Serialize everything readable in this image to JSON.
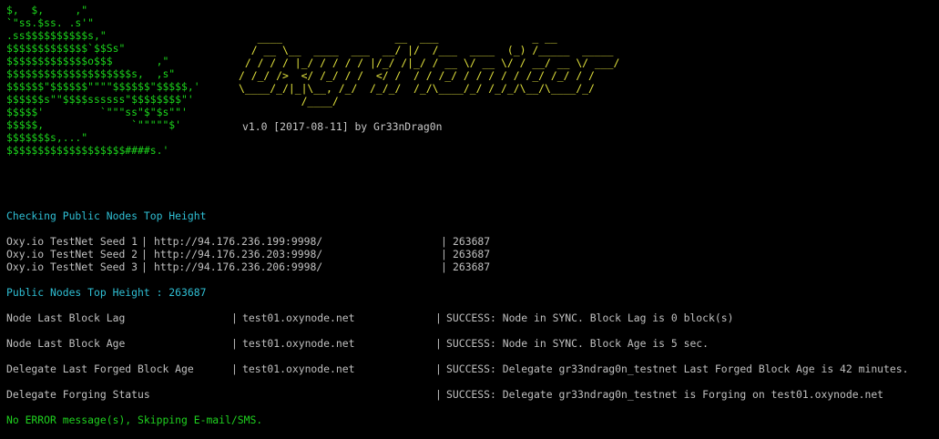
{
  "colors": {
    "background": "#000000",
    "dollar_art": "#1cd61c",
    "banner_art": "#e3e33d",
    "version": "#c8c8c8",
    "heading": "#2fbfd4",
    "text": "#c0c0c0",
    "final_status": "#1fd21f"
  },
  "dollar_art": [
    "$,  $,     ,\"",
    "`\"ss.$ss. .s'\"",
    ".ss$$$$$$$$$$s,\"",
    "$$$$$$$$$$$$$`$$Ss\"",
    "$$$$$$$$$$$$$o$$$       ,\"",
    "$$$$$$$$$$$$$$$$$$$$s,  ,s\"",
    "$$$$$$\"$$$$$$\"\"\"\"$$$$$$\"$$$$$,'",
    "$$$$$$s\"\"$$$$ssssss\"$$$$$$$$\"'",
    "$$$$$'         `\"\"\"ss\"$\"$s\"\"'",
    "$$$$$,              `\"\"\"\"\"$'",
    "$$$$$$$s,...\"",
    "$$$$$$$$$$$$$$$$$$$####s.'"
  ],
  "banner_art": [
    "   ____                  __  ___               _ __",
    "  / __ \\__  ____  ___  __/ |/  /___  ____  (_) /_____  _____",
    " / / / / |_/ / / / / |/_/ /|_/ / __ \\/ __ \\/ / __/ __ \\/ ___/",
    "/ /_/ />  </ /_/ / /  </ /  / / /_/ / / / / / /_/ /_/ / /",
    "\\____/_/|_|\\__, /_/  /_/_/  /_/\\____/_/ /_/_/\\__/\\____/_/",
    "          /____/"
  ],
  "version_line": "v1.0 [2017-08-11] by Gr33nDrag0n",
  "heading_checking": "Checking Public Nodes Top Height",
  "seed_rows": [
    {
      "name": "Oxy.io TestNet Seed 1",
      "url": "http://94.176.236.199:9998/",
      "height": "263687"
    },
    {
      "name": "Oxy.io TestNet Seed 2",
      "url": "http://94.176.236.203:9998/",
      "height": "263687"
    },
    {
      "name": "Oxy.io TestNet Seed 3",
      "url": "http://94.176.236.206:9998/",
      "height": "263687"
    }
  ],
  "heading_top_height": "Public Nodes Top Height : 263687",
  "checks": [
    {
      "name": "Node Last Block Lag",
      "node": "test01.oxynode.net",
      "result": "SUCCESS: Node in SYNC. Block Lag is 0 block(s)"
    },
    {
      "name": "Node Last Block Age",
      "node": "test01.oxynode.net",
      "result": "SUCCESS: Node in SYNC. Block Age is 5 sec."
    },
    {
      "name": "Delegate Last Forged Block Age",
      "node": "test01.oxynode.net",
      "result": "SUCCESS: Delegate gr33ndrag0n_testnet Last Forged Block Age is 42 minutes."
    },
    {
      "name": "Delegate Forging Status",
      "node": "",
      "result": "SUCCESS: Delegate gr33ndrag0n_testnet is Forging on test01.oxynode.net"
    }
  ],
  "final_status": "No ERROR message(s), Skipping E-mail/SMS."
}
